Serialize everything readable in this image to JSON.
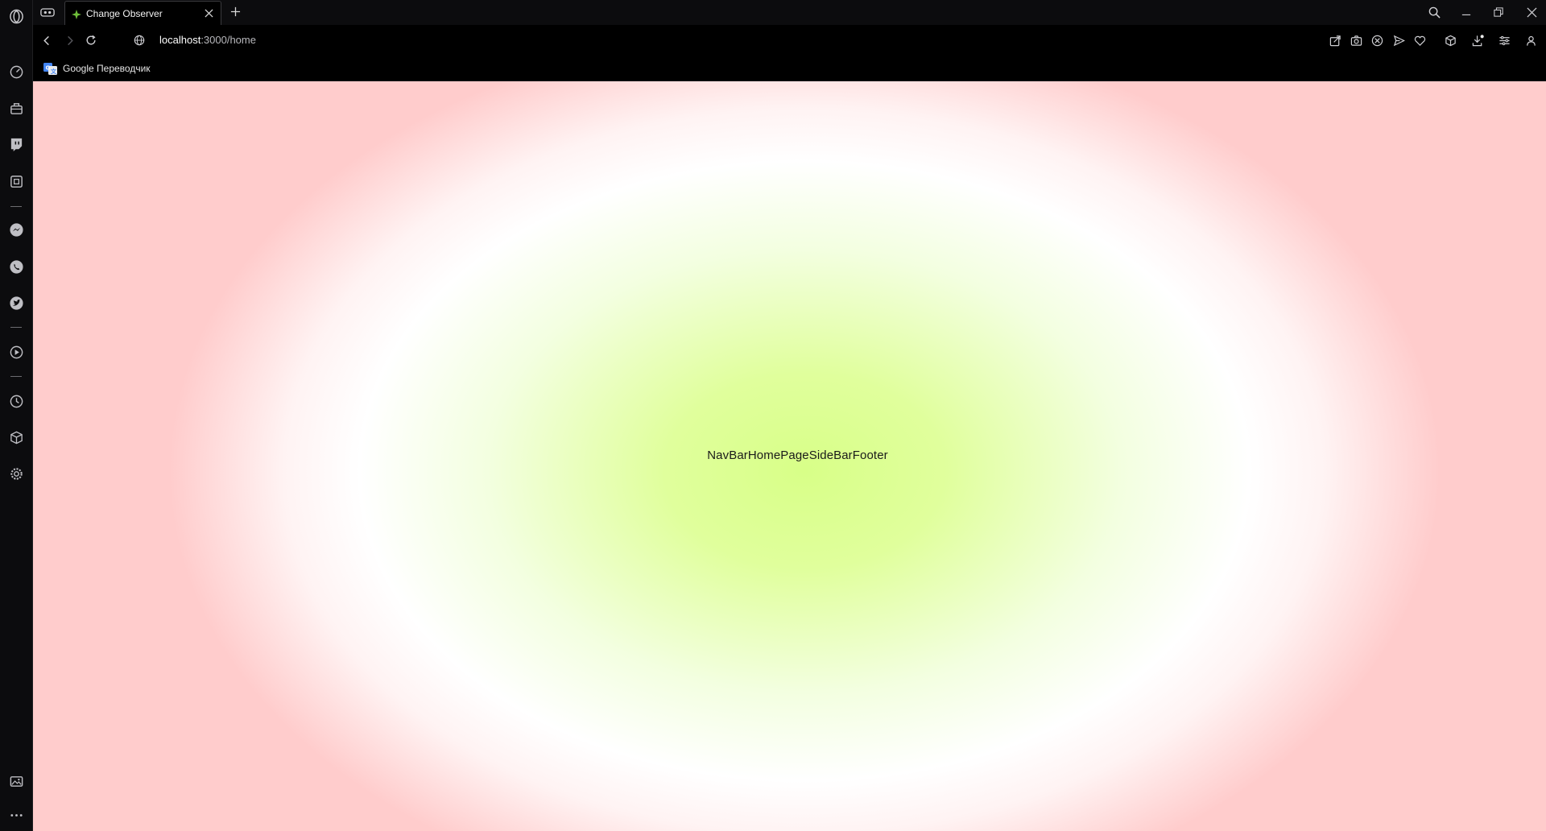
{
  "browser": {
    "tab": {
      "title": "Change Observer"
    },
    "address": {
      "host": "localhost",
      "path": ":3000/home"
    },
    "bookmarks": [
      {
        "label": "Google Переводчик"
      }
    ]
  },
  "page": {
    "content_text": "NavBarHomePageSideBarFooter",
    "colors": {
      "center": "#d8ff88",
      "mid": "#ffffff",
      "edge": "#ffcccc"
    }
  },
  "icons": {
    "sidebar": [
      "browser-logo-icon",
      "speed-dial-icon",
      "shopping-icon",
      "twitch-icon",
      "extensions-box-icon",
      "messenger-icon",
      "whatsapp-icon",
      "twitter-icon",
      "player-icon",
      "history-icon",
      "cube-icon",
      "settings-icon",
      "gallery-icon",
      "more-icon"
    ],
    "toolbar": [
      "share-icon",
      "snapshot-icon",
      "block-ads-icon",
      "send-icon",
      "heart-icon",
      "cube-icon",
      "download-icon",
      "easy-setup-icon",
      "profile-icon"
    ]
  }
}
